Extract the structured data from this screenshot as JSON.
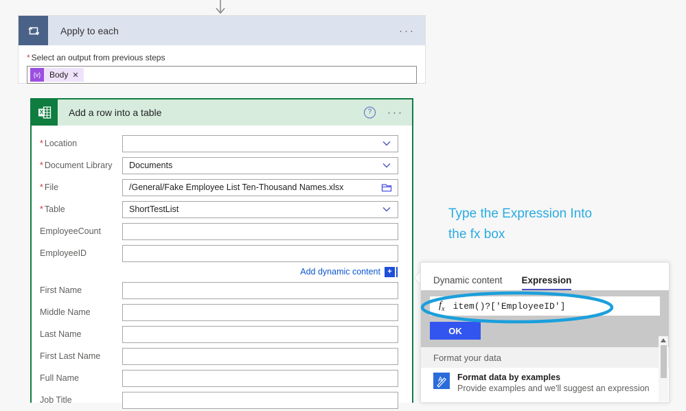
{
  "colors": {
    "loop_header_bg": "#dde3ee",
    "loop_icon_bg": "#4a6288",
    "excel_green": "#107c41",
    "excel_header_bg": "#d7ecdd",
    "annotation_blue": "#29abe2",
    "link_blue": "#0b57d0",
    "ok_button_blue": "#3355ef",
    "required_star_red": "#d13438",
    "token_purple": "#9b4fe0"
  },
  "connector": {
    "icon": "arrow-down-icon"
  },
  "apply_to_each": {
    "icon": "loop-icon",
    "title": "Apply to each",
    "overflow_icon": "ellipsis-icon",
    "output_field": {
      "required": true,
      "label": "Select an output from previous steps",
      "token": {
        "icon_text": "{v}",
        "label": "Body",
        "remove_icon": "close-icon"
      }
    }
  },
  "excel_action": {
    "icon": "excel-icon",
    "title": "Add a row into a table",
    "help_icon": "help-circle-icon",
    "overflow_icon": "ellipsis-icon",
    "fields": [
      {
        "label": "Location",
        "required": true,
        "value": "",
        "control": "dropdown"
      },
      {
        "label": "Document Library",
        "required": true,
        "value": "Documents",
        "control": "dropdown"
      },
      {
        "label": "File",
        "required": true,
        "value": "/General/Fake Employee List Ten-Thousand Names.xlsx",
        "control": "file-picker"
      },
      {
        "label": "Table",
        "required": true,
        "value": "ShortTestList",
        "control": "dropdown"
      },
      {
        "label": "EmployeeCount",
        "required": false,
        "value": "",
        "control": "text"
      },
      {
        "label": "EmployeeID",
        "required": false,
        "value": "",
        "control": "text"
      }
    ],
    "dynamic_content": {
      "link_label": "Add dynamic content",
      "badge_label": "+"
    },
    "fields_after": [
      {
        "label": "First Name",
        "required": false,
        "value": "",
        "control": "text"
      },
      {
        "label": "Middle Name",
        "required": false,
        "value": "",
        "control": "text"
      },
      {
        "label": "Last Name",
        "required": false,
        "value": "",
        "control": "text"
      },
      {
        "label": "First Last Name",
        "required": false,
        "value": "",
        "control": "text"
      },
      {
        "label": "Full Name",
        "required": false,
        "value": "",
        "control": "text"
      },
      {
        "label": "Job Title",
        "required": false,
        "value": "",
        "control": "text"
      }
    ]
  },
  "annotation": {
    "line1": "Type the Expression Into",
    "line2": "the fx box",
    "highlight_shape": "ellipse-annotation"
  },
  "expression_panel": {
    "tabs": [
      {
        "label": "Dynamic content",
        "active": false
      },
      {
        "label": "Expression",
        "active": true
      }
    ],
    "expression_input": {
      "fx_label": "fx",
      "value": "item()?['EmployeeID']"
    },
    "ok_label": "OK",
    "format_section_title": "Format your data",
    "format_item": {
      "icon": "format-data-icon",
      "title": "Format data by examples",
      "subtitle": "Provide examples and we'll suggest an expression"
    },
    "scrollbar": {
      "up_icon": "caret-up-icon"
    }
  }
}
